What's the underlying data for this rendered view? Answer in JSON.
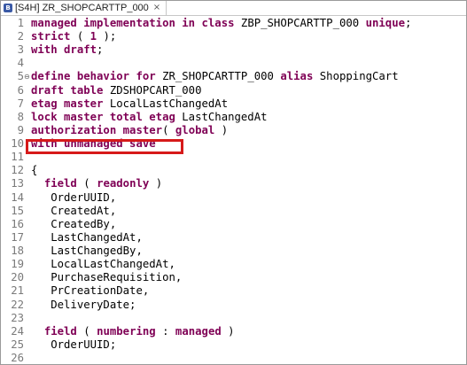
{
  "tab": {
    "icon": "abap-behavior-icon",
    "title": "[S4H] ZR_SHOPCARTTP_000",
    "close": "×"
  },
  "lines": [
    {
      "n": "1",
      "parts": [
        {
          "t": "managed implementation in class",
          "k": 1
        },
        {
          "t": " ZBP_SHOPCARTTP_000 ",
          "k": 0
        },
        {
          "t": "unique",
          "k": 1
        },
        {
          "t": ";",
          "k": 0
        }
      ]
    },
    {
      "n": "2",
      "parts": [
        {
          "t": "strict",
          "k": 1
        },
        {
          "t": " ( ",
          "k": 0
        },
        {
          "t": "1",
          "k": 1
        },
        {
          "t": " );",
          "k": 0
        }
      ]
    },
    {
      "n": "3",
      "parts": [
        {
          "t": "with draft",
          "k": 1
        },
        {
          "t": ";",
          "k": 0
        }
      ]
    },
    {
      "n": "4",
      "parts": []
    },
    {
      "n": "5",
      "fold": "⊖",
      "parts": [
        {
          "t": "define behavior for",
          "k": 1
        },
        {
          "t": " ZR_SHOPCARTTP_000 ",
          "k": 0
        },
        {
          "t": "alias",
          "k": 1
        },
        {
          "t": " ShoppingCart",
          "k": 0
        }
      ]
    },
    {
      "n": "6",
      "parts": [
        {
          "t": "draft table",
          "k": 1
        },
        {
          "t": " ZDSHOPCART_000",
          "k": 0
        }
      ]
    },
    {
      "n": "7",
      "parts": [
        {
          "t": "etag master",
          "k": 1
        },
        {
          "t": " LocalLastChangedAt",
          "k": 0
        }
      ]
    },
    {
      "n": "8",
      "parts": [
        {
          "t": "lock master total etag",
          "k": 1
        },
        {
          "t": " LastChangedAt",
          "k": 0
        }
      ]
    },
    {
      "n": "9",
      "parts": [
        {
          "t": "authorization master",
          "k": 1
        },
        {
          "t": "( ",
          "k": 0
        },
        {
          "t": "global",
          "k": 1
        },
        {
          "t": " )",
          "k": 0
        }
      ]
    },
    {
      "n": "10",
      "parts": [
        {
          "t": "with unmanaged save",
          "k": 1
        }
      ]
    },
    {
      "n": "11",
      "parts": []
    },
    {
      "n": "12",
      "parts": [
        {
          "t": "{",
          "k": 0
        }
      ]
    },
    {
      "n": "13",
      "parts": [
        {
          "t": "  ",
          "k": 0
        },
        {
          "t": "field",
          "k": 1
        },
        {
          "t": " ( ",
          "k": 0
        },
        {
          "t": "readonly",
          "k": 1
        },
        {
          "t": " )",
          "k": 0
        }
      ]
    },
    {
      "n": "14",
      "parts": [
        {
          "t": "   OrderUUID,",
          "k": 0
        }
      ]
    },
    {
      "n": "15",
      "parts": [
        {
          "t": "   CreatedAt,",
          "k": 0
        }
      ]
    },
    {
      "n": "16",
      "parts": [
        {
          "t": "   CreatedBy,",
          "k": 0
        }
      ]
    },
    {
      "n": "17",
      "parts": [
        {
          "t": "   LastChangedAt,",
          "k": 0
        }
      ]
    },
    {
      "n": "18",
      "parts": [
        {
          "t": "   LastChangedBy,",
          "k": 0
        }
      ]
    },
    {
      "n": "19",
      "parts": [
        {
          "t": "   LocalLastChangedAt,",
          "k": 0
        }
      ]
    },
    {
      "n": "20",
      "parts": [
        {
          "t": "   PurchaseRequisition,",
          "k": 0
        }
      ]
    },
    {
      "n": "21",
      "parts": [
        {
          "t": "   PrCreationDate,",
          "k": 0
        }
      ]
    },
    {
      "n": "22",
      "parts": [
        {
          "t": "   DeliveryDate;",
          "k": 0
        }
      ]
    },
    {
      "n": "23",
      "parts": []
    },
    {
      "n": "24",
      "parts": [
        {
          "t": "  ",
          "k": 0
        },
        {
          "t": "field",
          "k": 1
        },
        {
          "t": " ( ",
          "k": 0
        },
        {
          "t": "numbering",
          "k": 1
        },
        {
          "t": " : ",
          "k": 0
        },
        {
          "t": "managed",
          "k": 1
        },
        {
          "t": " )",
          "k": 0
        }
      ]
    },
    {
      "n": "25",
      "parts": [
        {
          "t": "   OrderUUID;",
          "k": 0
        }
      ]
    },
    {
      "n": "26",
      "parts": []
    }
  ],
  "highlight_line": "10",
  "colors": {
    "keyword": "#7f0055",
    "highlight_border": "#d61a1a",
    "line_number": "#7a7a7a"
  }
}
